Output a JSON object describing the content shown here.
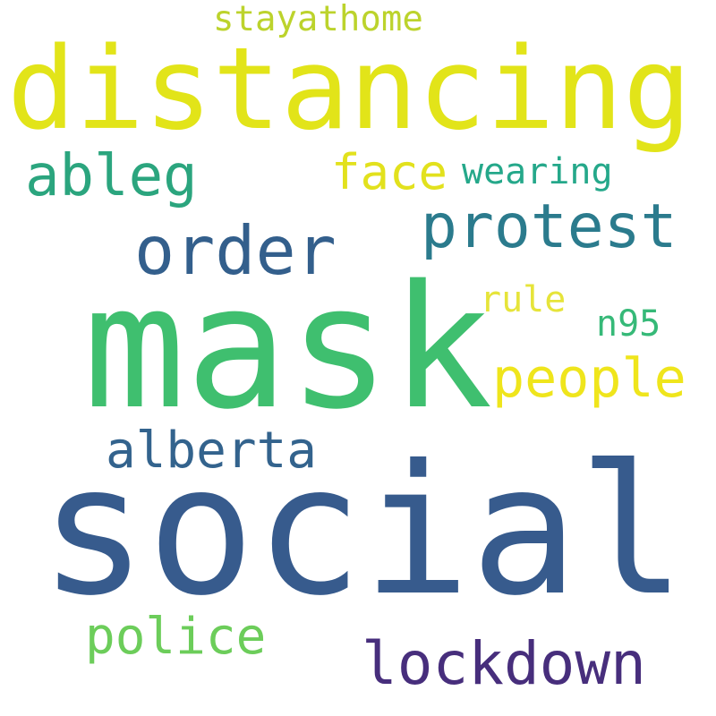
{
  "word_cloud": {
    "background": "#ffffff",
    "words": [
      {
        "text": "stayathome",
        "color": "#bcd32c"
      },
      {
        "text": "distancing",
        "color": "#e2e419"
      },
      {
        "text": "ableg",
        "color": "#2ba57e"
      },
      {
        "text": "face",
        "color": "#e2e11d"
      },
      {
        "text": "wearing",
        "color": "#25a88a"
      },
      {
        "text": "protest",
        "color": "#2b7b8d"
      },
      {
        "text": "order",
        "color": "#335f8c"
      },
      {
        "text": "mask",
        "color": "#3fbf6f"
      },
      {
        "text": "rule",
        "color": "#e6e43a"
      },
      {
        "text": "n95",
        "color": "#36b978"
      },
      {
        "text": "people",
        "color": "#efe51c"
      },
      {
        "text": "alberta",
        "color": "#33638d"
      },
      {
        "text": "social",
        "color": "#375b8d"
      },
      {
        "text": "police",
        "color": "#6ccd5a"
      },
      {
        "text": "lockdown",
        "color": "#472e7c"
      }
    ]
  }
}
